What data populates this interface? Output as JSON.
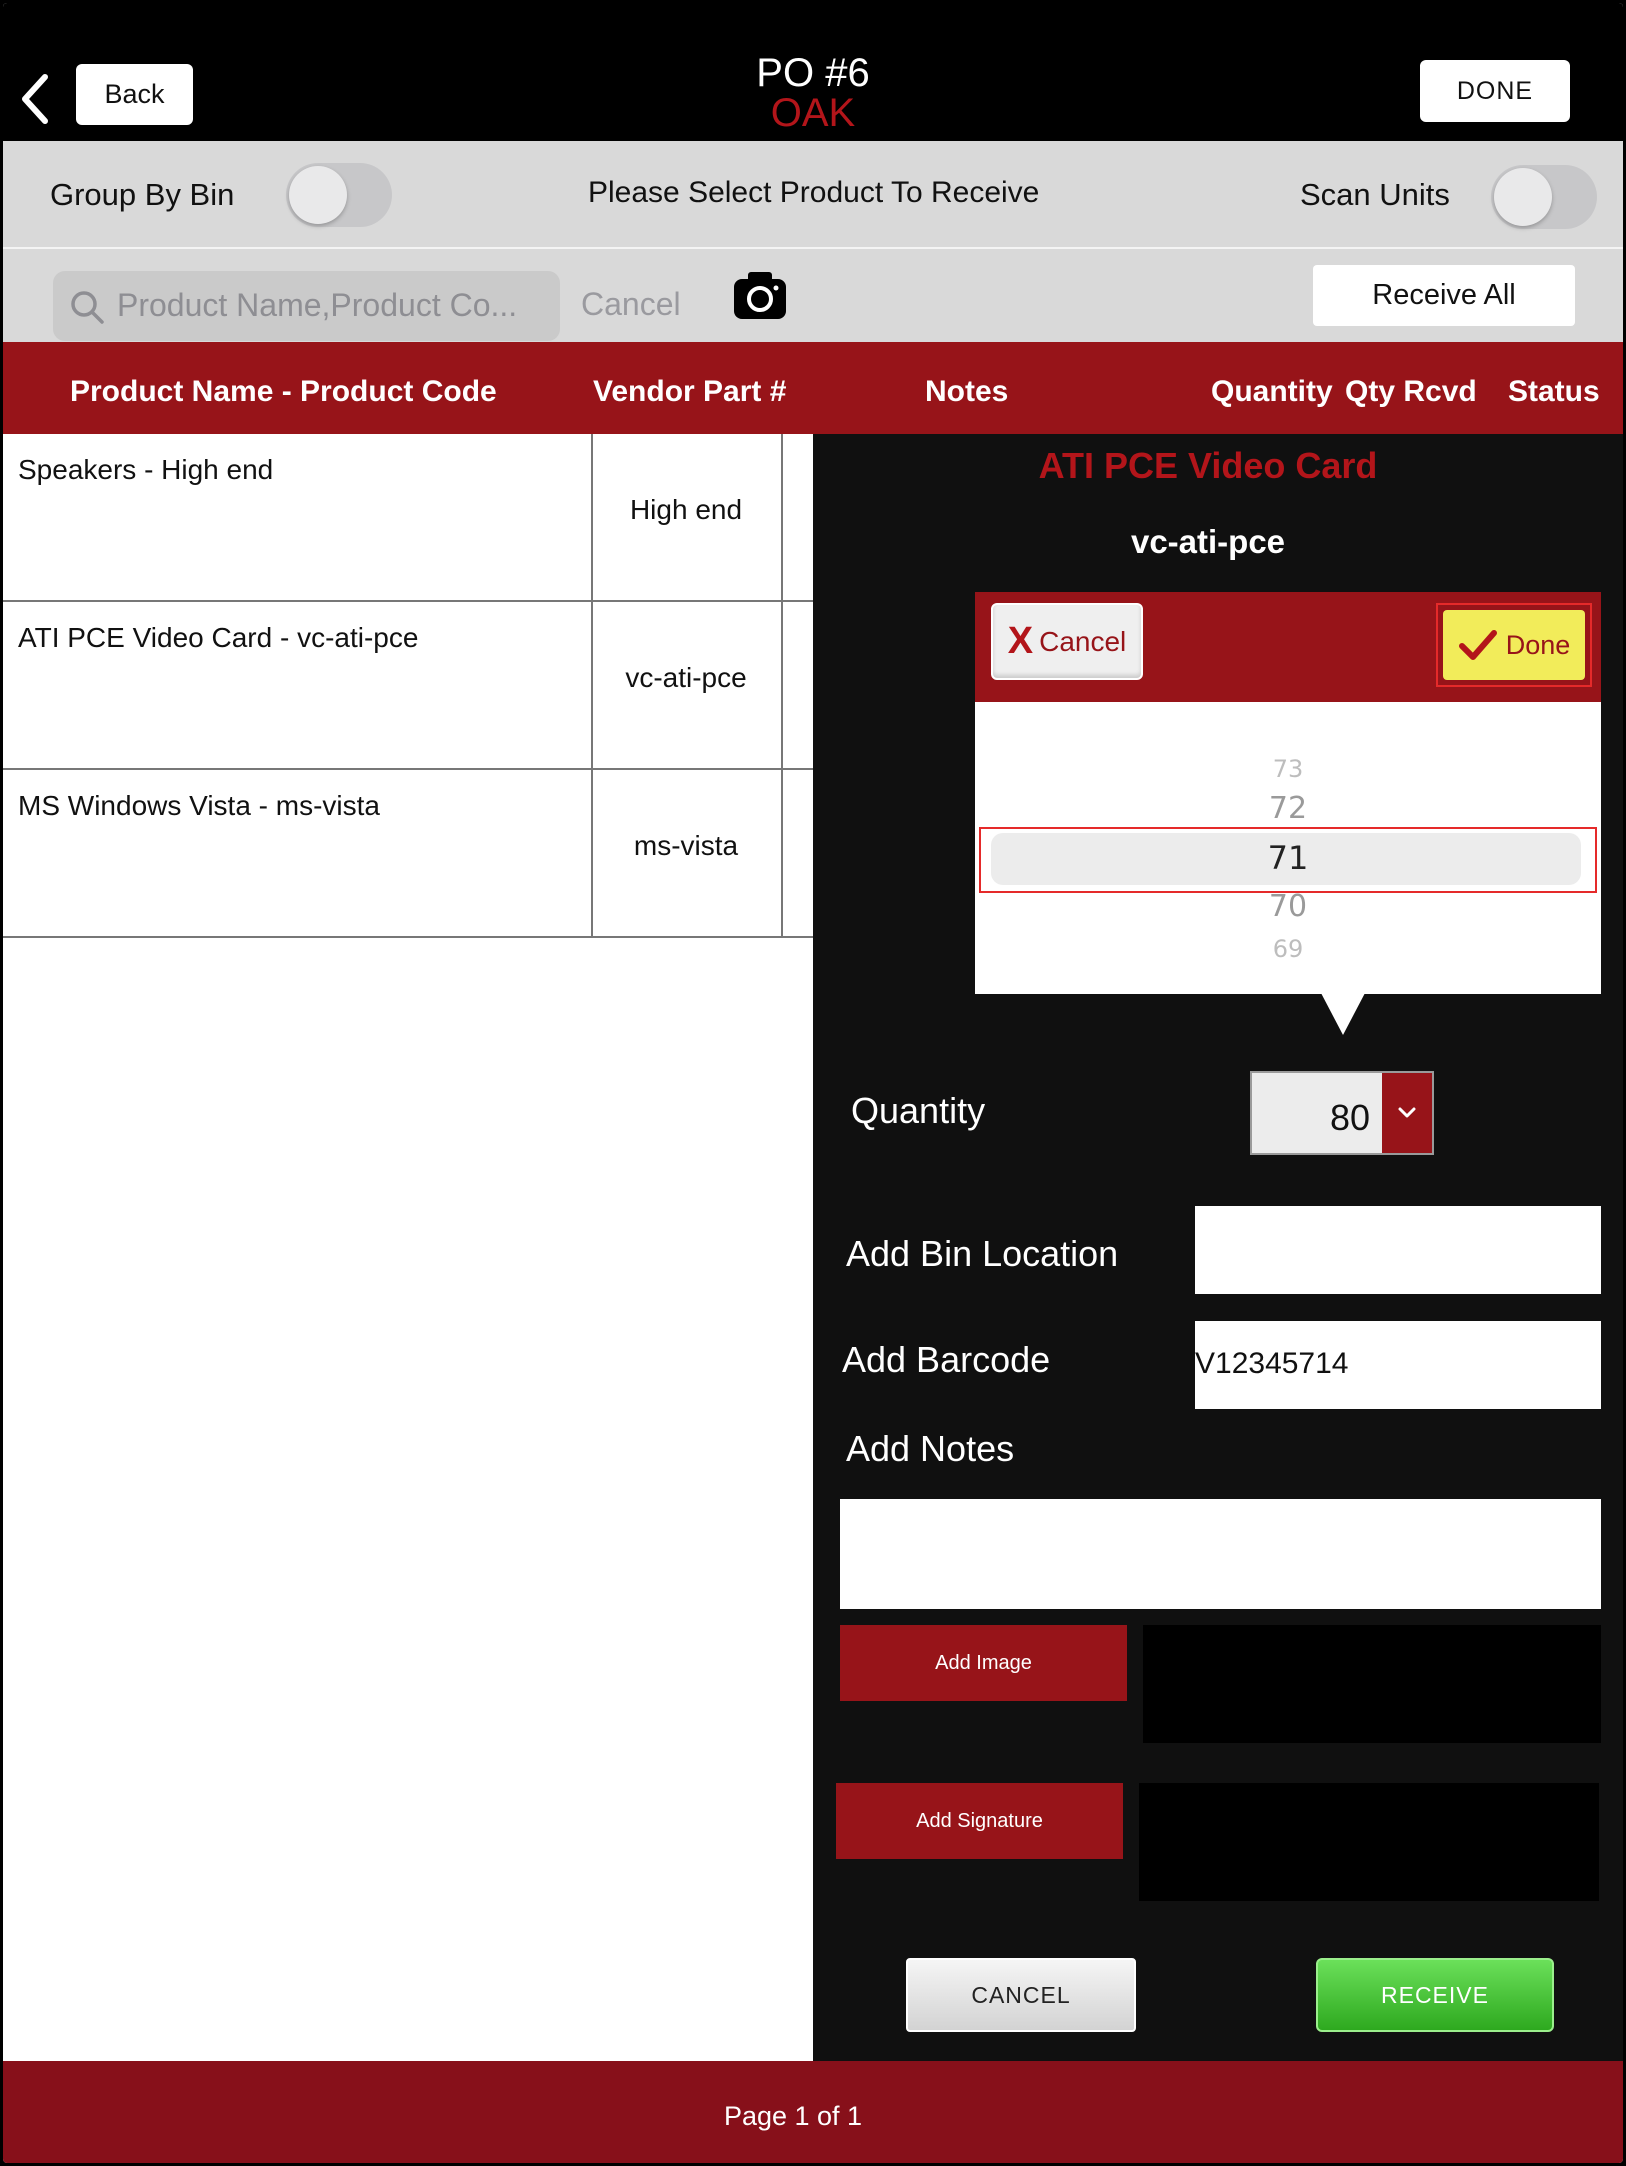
{
  "header": {
    "back_label": "Back",
    "title": "PO #6",
    "subtitle": "OAK",
    "done_label": "DONE"
  },
  "toolbar": {
    "group_by_bin_label": "Group By Bin",
    "group_by_bin_on": false,
    "prompt": "Please Select Product To Receive",
    "scan_units_label": "Scan Units",
    "scan_units_on": false,
    "search_placeholder": "Product Name,Product Co...",
    "search_cancel": "Cancel",
    "receive_all_label": "Receive All"
  },
  "table": {
    "headers": {
      "product": "Product Name - Product Code",
      "vendor_part": "Vendor Part #",
      "notes": "Notes",
      "quantity": "Quantity",
      "qty_rcvd": "Qty Rcvd",
      "status": "Status"
    },
    "rows": [
      {
        "name": "Speakers - High end",
        "vendor_part": "High end"
      },
      {
        "name": "ATI PCE Video Card - vc-ati-pce",
        "vendor_part": "vc-ati-pce"
      },
      {
        "name": "MS Windows Vista - ms-vista",
        "vendor_part": "ms-vista"
      }
    ]
  },
  "panel": {
    "product_title": "ATI PCE Video Card",
    "product_code": "vc-ati-pce",
    "picker": {
      "cancel_label": "Cancel",
      "done_label": "Done",
      "values": [
        "73",
        "72",
        "71",
        "70",
        "69"
      ],
      "selected": "71"
    },
    "quantity_label": "Quantity",
    "quantity_value": "80",
    "bin_label": "Add Bin Location",
    "bin_value": "",
    "barcode_label": "Add Barcode",
    "barcode_value": "V12345714",
    "notes_label": "Add Notes",
    "notes_value": "",
    "add_image_label": "Add Image",
    "add_signature_label": "Add Signature",
    "cancel_label": "CANCEL",
    "receive_label": "RECEIVE"
  },
  "footer": {
    "page_label": "Page 1 of 1"
  },
  "colors": {
    "brand_red": "#971419",
    "title_red": "#b3151a",
    "highlight_yellow": "#f2ec5a",
    "receive_green": "#3dbb2b"
  }
}
